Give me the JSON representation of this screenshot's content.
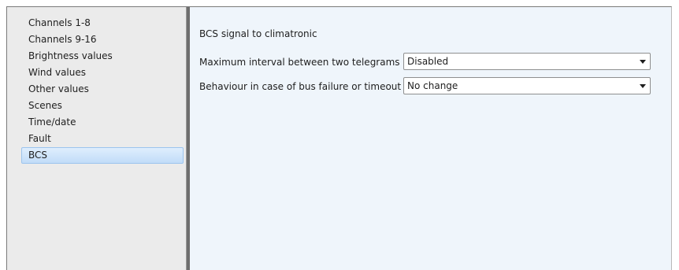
{
  "sidebar": {
    "items": [
      {
        "label": "Channels 1-8"
      },
      {
        "label": "Channels 9-16"
      },
      {
        "label": "Brightness values"
      },
      {
        "label": "Wind values"
      },
      {
        "label": "Other values"
      },
      {
        "label": "Scenes"
      },
      {
        "label": "Time/date"
      },
      {
        "label": "Fault"
      },
      {
        "label": "BCS",
        "selected": true
      }
    ]
  },
  "main": {
    "section_title": "BCS signal to climatronic",
    "params": [
      {
        "label": "Maximum interval between two telegrams",
        "value": "Disabled"
      },
      {
        "label": "Behaviour in case of bus failure or timeout",
        "value": "No change"
      }
    ]
  },
  "colors": {
    "sidebar_bg": "#ebebeb",
    "main_bg": "#eff5fb",
    "selection": "#c1dcf8",
    "splitter": "#6e6e6e"
  },
  "icons": {
    "dropdown": "chevron-down-icon"
  }
}
